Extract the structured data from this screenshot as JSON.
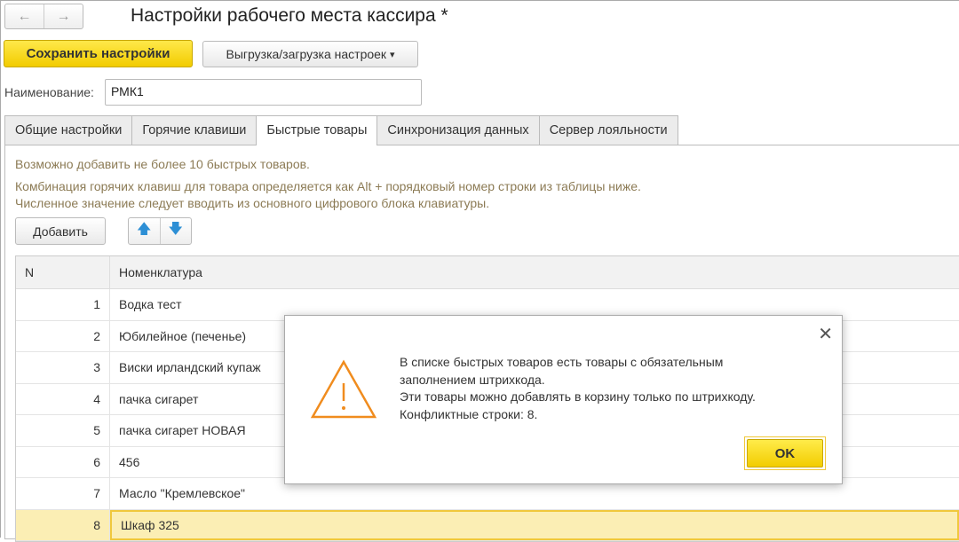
{
  "window": {
    "title": "Настройки рабочего места кассира *",
    "back_icon": "←",
    "forward_icon": "→"
  },
  "toolbar": {
    "save_label": "Сохранить настройки",
    "export_label": "Выгрузка/загрузка настроек",
    "export_arrow": "▾"
  },
  "name_field": {
    "label": "Наименование:",
    "value": "РМК1"
  },
  "tabs": [
    {
      "label": "Общие настройки"
    },
    {
      "label": "Горячие клавиши"
    },
    {
      "label": "Быстрые товары"
    },
    {
      "label": "Синхронизация данных"
    },
    {
      "label": "Сервер лояльности"
    }
  ],
  "info": [
    "Возможно добавить не более 10 быстрых товаров.",
    "Комбинация горячих клавиш для товара определяется как Alt + порядковый номер строки из таблицы ниже.",
    "Численное значение следует вводить из основного цифрового блока клавиатуры."
  ],
  "table_toolbar": {
    "add_label": "Добавить",
    "up_icon": "🡅",
    "down_icon": "🡇"
  },
  "table": {
    "headers": [
      "N",
      "Номенклатура"
    ],
    "rows": [
      {
        "n": "1",
        "name": "Водка тест"
      },
      {
        "n": "2",
        "name": "Юбилейное (печенье)"
      },
      {
        "n": "3",
        "name": "Виски ирландский купаж"
      },
      {
        "n": "4",
        "name": "пачка сигарет"
      },
      {
        "n": "5",
        "name": "пачка сигарет НОВАЯ"
      },
      {
        "n": "6",
        "name": "456"
      },
      {
        "n": "7",
        "name": "Масло \"Кремлевское\""
      },
      {
        "n": "8",
        "name": "Шкаф 325"
      }
    ]
  },
  "dialog": {
    "lines": [
      "В списке быстрых товаров есть товары с обязательным",
      "заполнением штрихкода.",
      "Эти товары можно добавлять в корзину только по штрихкоду.",
      "Конфликтные строки: 8."
    ],
    "ok_label": "OK",
    "close_icon": "✕"
  }
}
